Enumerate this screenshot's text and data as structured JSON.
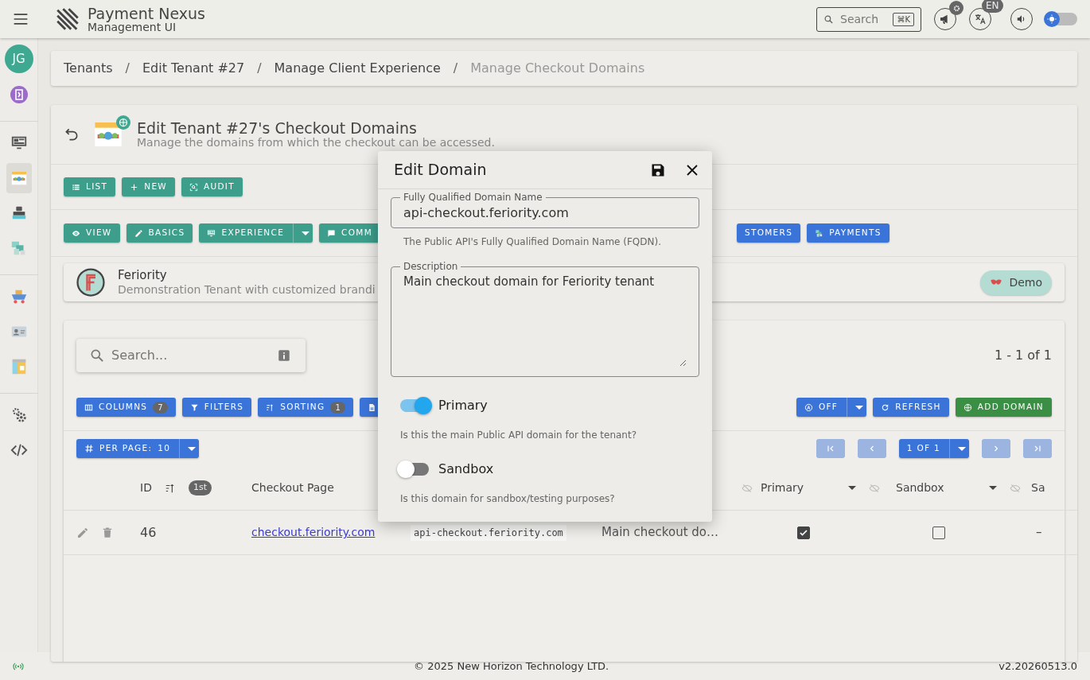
{
  "header": {
    "title": "Payment Nexus",
    "subtitle": "Management UI",
    "search": {
      "placeholder": "Search",
      "shortcut": "⌘K"
    },
    "language": "EN",
    "dark_mode": false
  },
  "sidebar": {
    "avatar": "JG",
    "groups": [
      [
        {
          "kind": "exit",
          "selected": false
        }
      ],
      [
        {
          "kind": "monitor",
          "selected": false
        },
        {
          "kind": "checkout",
          "selected": true
        },
        {
          "kind": "register",
          "selected": false
        },
        {
          "kind": "tiles",
          "selected": false
        }
      ],
      [
        {
          "kind": "cart",
          "selected": false
        },
        {
          "kind": "idcard",
          "selected": false
        },
        {
          "kind": "layout",
          "selected": false
        }
      ],
      [
        {
          "kind": "gears",
          "selected": false
        },
        {
          "kind": "code",
          "selected": false
        }
      ]
    ]
  },
  "breadcrumbs": [
    {
      "label": "Tenants",
      "selected": false
    },
    {
      "separator": "/",
      "label": "Edit Tenant #27",
      "selected": false
    },
    {
      "separator": "/",
      "label": "Manage Client Experience",
      "selected": false
    },
    {
      "separator": "/",
      "label": "Manage Checkout Domains",
      "selected": true
    }
  ],
  "page": {
    "title": "Edit Tenant #27's Checkout Domains",
    "subtitle": "Manage the domains from which the checkout can be accessed."
  },
  "actions": [
    {
      "label": "LIST",
      "kind": "list"
    },
    {
      "label": "NEW",
      "kind": "plus"
    },
    {
      "label": "AUDIT",
      "kind": "audit"
    }
  ],
  "sections": [
    {
      "label": "VIEW",
      "kind": "eye",
      "color": "#3d9e8c",
      "dropdown": false
    },
    {
      "label": "BASICS",
      "kind": "pencil",
      "color": "#3d9e8c",
      "dropdown": false
    },
    {
      "label": "EXPERIENCE",
      "kind": "monitor",
      "color": "#3d9e8c",
      "dropdown": true
    },
    {
      "label": "COMM",
      "kind": "chat",
      "color": "#3d9e8c",
      "dropdown": false
    },
    {
      "label": "STOMERS",
      "kind": "none",
      "color": "#3b74d9",
      "dropdown": false
    },
    {
      "label": "PAYMENTS",
      "kind": "tiles",
      "color": "#3b74d9",
      "dropdown": false
    }
  ],
  "tenant": {
    "name": "Feriority",
    "description": "Demonstration Tenant with customized brandi",
    "badge": "Demo"
  },
  "table": {
    "search_placeholder": "Search...",
    "count": "1 - 1 of 1",
    "toolbar": [
      {
        "label": "COLUMNS",
        "kind": "columns",
        "count": "7"
      },
      {
        "label": "FILTERS",
        "kind": "filter"
      },
      {
        "label": "SORTING",
        "kind": "sort",
        "count": "1"
      },
      {
        "kind": "file"
      }
    ],
    "tools_right": [
      {
        "label": "OFF",
        "kind": "auto",
        "dropdown": true,
        "color": "#3b74d9"
      },
      {
        "label": "REFRESH",
        "kind": "refresh",
        "dropdown": false,
        "color": "#3b74d9"
      },
      {
        "label": "ADD DOMAIN",
        "kind": "globe",
        "dropdown": false,
        "color": "#3a8f45"
      }
    ],
    "per_page": {
      "label": "PER PAGE:",
      "value": "10"
    },
    "pager": {
      "label": "1 OF 1",
      "first_disabled": true,
      "prev_disabled": true,
      "next_disabled": true,
      "last_disabled": true
    },
    "columns": [
      {
        "label": "ID",
        "sort_rank": "1st"
      },
      {
        "label": "Checkout Page"
      },
      {
        "hidden_toggle": true
      },
      {
        "label": "Primary",
        "menu": true,
        "hidden_toggle": true
      },
      {
        "label": "Sandbox",
        "menu": true,
        "hidden_toggle": true
      },
      {
        "label": "Sa"
      }
    ],
    "rows": [
      {
        "id": "46",
        "checkout_page": "checkout.feriority.com",
        "fqdn": "api-checkout.feriority.com",
        "description": "Main checkout do…",
        "primary": true,
        "sandbox": false,
        "column_6": "–"
      }
    ]
  },
  "dialog": {
    "title": "Edit Domain",
    "fields": [
      {
        "kind": "input",
        "label": "Fully Qualified Domain Name",
        "value": "api-checkout.feriority.com",
        "help": "The Public API's Fully Qualified Domain Name (FQDN)."
      },
      {
        "kind": "textarea",
        "label": "Description",
        "value": "Main checkout domain for Feriority tenant"
      }
    ],
    "toggles": [
      {
        "label": "Primary",
        "on": true,
        "help": "Is this the main Public API domain for the tenant?"
      },
      {
        "label": "Sandbox",
        "on": false,
        "help": "Is this domain for sandbox/testing purposes?"
      }
    ]
  },
  "footer": {
    "copyright": "© 2025 New Horizon Technology LTD.",
    "version": "v2.20260513.0"
  }
}
